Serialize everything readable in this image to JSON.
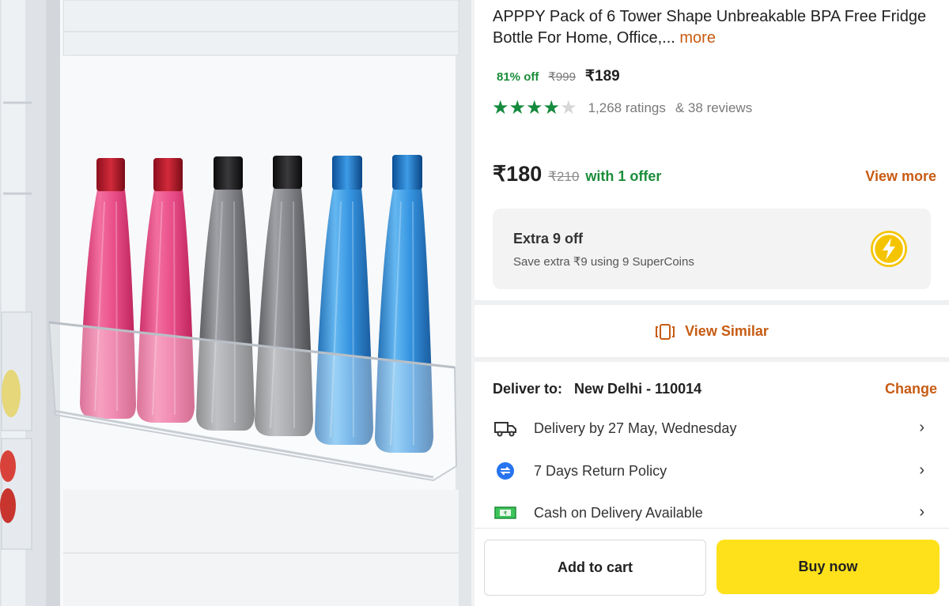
{
  "product": {
    "title": "APPPY Pack of 6 Tower Shape Unbreakable BPA Free Fridge Bottle For Home, Office,...",
    "more_label": "more",
    "discount": "81% off",
    "mrp": "₹999",
    "price": "₹189",
    "rating_stars": 4,
    "ratings_text": "1,268 ratings",
    "reviews_text": "& 38 reviews"
  },
  "offer": {
    "price": "₹180",
    "mrp": "₹210",
    "with_offer": "with 1 offer",
    "view_more": "View more"
  },
  "supercoin": {
    "title": "Extra 9 off",
    "subtitle": "Save extra ₹9 using 9 SuperCoins",
    "icon": "lightning-coin-icon"
  },
  "similar": {
    "label": "View Similar",
    "icon": "similar-icon"
  },
  "delivery": {
    "label": "Deliver to:",
    "location": "New Delhi - 110014",
    "change_label": "Change",
    "rows": [
      {
        "text": "Delivery by 27 May, Wednesday",
        "icon": "truck-icon"
      },
      {
        "text": "7 Days Return Policy",
        "icon": "return-icon"
      },
      {
        "text": "Cash on Delivery Available",
        "icon": "cash-icon"
      }
    ]
  },
  "actions": {
    "add_to_cart": "Add to cart",
    "buy_now": "Buy now"
  },
  "colors": {
    "accent": "#c75b12",
    "green": "#1b8d3a",
    "buy_button": "#ffe11b",
    "bottle_pink": "#e8407e",
    "bottle_grey": "#6d6e72",
    "bottle_blue": "#1d7fd0"
  }
}
